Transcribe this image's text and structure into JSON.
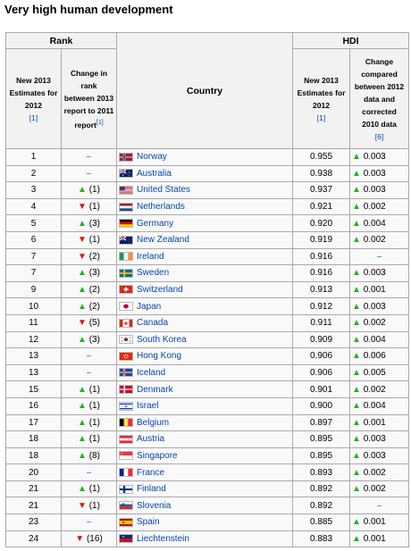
{
  "title": "Very high human development",
  "headers": {
    "rank": "Rank",
    "hdi": "HDI",
    "country": "Country",
    "rank_new_a": "New 2013",
    "rank_new_b": "Estimates for",
    "rank_new_c": "2012",
    "rank_new_ref": "[1]",
    "rank_change_a": "Change in",
    "rank_change_b": "rank",
    "rank_change_c": "between 2013",
    "rank_change_d": "report to 2011",
    "rank_change_e": "report",
    "rank_change_ref": "[1]",
    "hdi_new_a": "New 2013",
    "hdi_new_b": "Estimates for",
    "hdi_new_c": "2012",
    "hdi_new_ref": "[1]",
    "hdi_change_a": "Change",
    "hdi_change_b": "compared",
    "hdi_change_c": "between 2012",
    "hdi_change_d": "data and",
    "hdi_change_e": "corrected",
    "hdi_change_f": "2010 data",
    "hdi_change_ref": "[6]"
  },
  "colors": {
    "up": "#1db61d",
    "down": "#e01010",
    "same": "#3aa6e8",
    "link": "#0645ad"
  },
  "rows": [
    {
      "rank": "1",
      "dir": "same",
      "change": "",
      "country": "Norway",
      "flag": "norway",
      "hdi": "0.955",
      "hdir": "up",
      "hdic": "0.003"
    },
    {
      "rank": "2",
      "dir": "same",
      "change": "",
      "country": "Australia",
      "flag": "australia",
      "hdi": "0.938",
      "hdir": "up",
      "hdic": "0.003"
    },
    {
      "rank": "3",
      "dir": "up",
      "change": "(1)",
      "country": "United States",
      "flag": "usa",
      "hdi": "0.937",
      "hdir": "up",
      "hdic": "0.003"
    },
    {
      "rank": "4",
      "dir": "down",
      "change": "(1)",
      "country": "Netherlands",
      "flag": "netherlands",
      "hdi": "0.921",
      "hdir": "up",
      "hdic": "0.002"
    },
    {
      "rank": "5",
      "dir": "up",
      "change": "(3)",
      "country": "Germany",
      "flag": "germany",
      "hdi": "0.920",
      "hdir": "up",
      "hdic": "0.004"
    },
    {
      "rank": "6",
      "dir": "down",
      "change": "(1)",
      "country": "New Zealand",
      "flag": "newzealand",
      "hdi": "0.919",
      "hdir": "up",
      "hdic": "0.002"
    },
    {
      "rank": "7",
      "dir": "down",
      "change": "(2)",
      "country": "Ireland",
      "flag": "ireland",
      "hdi": "0.916",
      "hdir": "same",
      "hdic": ""
    },
    {
      "rank": "7",
      "dir": "up",
      "change": "(3)",
      "country": "Sweden",
      "flag": "sweden",
      "hdi": "0.916",
      "hdir": "up",
      "hdic": "0.003"
    },
    {
      "rank": "9",
      "dir": "up",
      "change": "(2)",
      "country": "Switzerland",
      "flag": "switzerland",
      "hdi": "0.913",
      "hdir": "up",
      "hdic": "0.001"
    },
    {
      "rank": "10",
      "dir": "up",
      "change": "(2)",
      "country": "Japan",
      "flag": "japan",
      "hdi": "0.912",
      "hdir": "up",
      "hdic": "0.003"
    },
    {
      "rank": "11",
      "dir": "down",
      "change": "(5)",
      "country": "Canada",
      "flag": "canada",
      "hdi": "0.911",
      "hdir": "up",
      "hdic": "0.002"
    },
    {
      "rank": "12",
      "dir": "up",
      "change": "(3)",
      "country": "South Korea",
      "flag": "southkorea",
      "hdi": "0.909",
      "hdir": "up",
      "hdic": "0.004"
    },
    {
      "rank": "13",
      "dir": "same",
      "change": "",
      "country": "Hong Kong",
      "flag": "hongkong",
      "hdi": "0.906",
      "hdir": "up",
      "hdic": "0.006"
    },
    {
      "rank": "13",
      "dir": "same",
      "change": "",
      "country": "Iceland",
      "flag": "iceland",
      "hdi": "0.906",
      "hdir": "up",
      "hdic": "0.005"
    },
    {
      "rank": "15",
      "dir": "up",
      "change": "(1)",
      "country": "Denmark",
      "flag": "denmark",
      "hdi": "0.901",
      "hdir": "up",
      "hdic": "0.002"
    },
    {
      "rank": "16",
      "dir": "up",
      "change": "(1)",
      "country": "Israel",
      "flag": "israel",
      "hdi": "0.900",
      "hdir": "up",
      "hdic": "0.004"
    },
    {
      "rank": "17",
      "dir": "up",
      "change": "(1)",
      "country": "Belgium",
      "flag": "belgium",
      "hdi": "0.897",
      "hdir": "up",
      "hdic": "0.001"
    },
    {
      "rank": "18",
      "dir": "up",
      "change": "(1)",
      "country": "Austria",
      "flag": "austria",
      "hdi": "0.895",
      "hdir": "up",
      "hdic": "0.003"
    },
    {
      "rank": "18",
      "dir": "up",
      "change": "(8)",
      "country": "Singapore",
      "flag": "singapore",
      "hdi": "0.895",
      "hdir": "up",
      "hdic": "0.003"
    },
    {
      "rank": "20",
      "dir": "same",
      "change": "",
      "country": "France",
      "flag": "france",
      "hdi": "0.893",
      "hdir": "up",
      "hdic": "0.002"
    },
    {
      "rank": "21",
      "dir": "up",
      "change": "(1)",
      "country": "Finland",
      "flag": "finland",
      "hdi": "0.892",
      "hdir": "up",
      "hdic": "0.002"
    },
    {
      "rank": "21",
      "dir": "down",
      "change": "(1)",
      "country": "Slovenia",
      "flag": "slovenia",
      "hdi": "0.892",
      "hdir": "same",
      "hdic": ""
    },
    {
      "rank": "23",
      "dir": "same",
      "change": "",
      "country": "Spain",
      "flag": "spain",
      "hdi": "0.885",
      "hdir": "up",
      "hdic": "0.001"
    },
    {
      "rank": "24",
      "dir": "down",
      "change": "(16)",
      "country": "Liechtenstein",
      "flag": "liechtenstein",
      "hdi": "0.883",
      "hdir": "up",
      "hdic": "0.001"
    }
  ]
}
